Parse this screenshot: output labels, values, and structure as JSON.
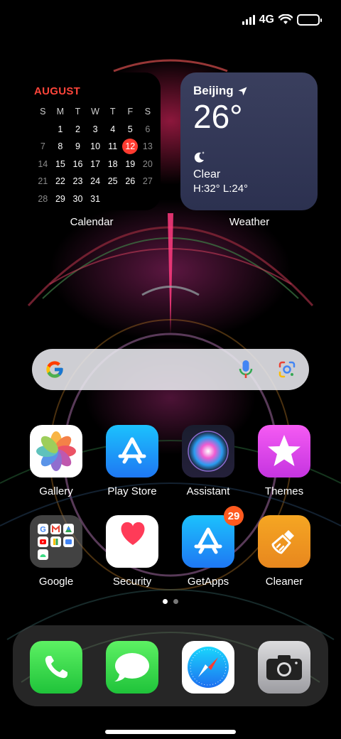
{
  "status_bar": {
    "network": "4G",
    "signal_icon": "cellular-signal-icon",
    "wifi_icon": "wifi-icon",
    "battery_icon": "battery-icon"
  },
  "calendar_widget": {
    "month": "AUGUST",
    "weekdays": [
      "S",
      "M",
      "T",
      "W",
      "T",
      "F",
      "S"
    ],
    "weeks": [
      [
        "",
        "",
        "1",
        "2",
        "3",
        "4",
        "5",
        "6"
      ],
      [
        "7",
        "8",
        "9",
        "10",
        "11",
        "12",
        "13"
      ],
      [
        "14",
        "15",
        "16",
        "17",
        "18",
        "19",
        "20"
      ],
      [
        "21",
        "22",
        "23",
        "24",
        "25",
        "26",
        "27"
      ],
      [
        "28",
        "29",
        "30",
        "31",
        "",
        "",
        ""
      ]
    ],
    "today": "12",
    "label": "Calendar"
  },
  "weather_widget": {
    "city": "Beijing",
    "temperature": "26°",
    "condition": "Clear",
    "high_low": "H:32°  L:24°",
    "label": "Weather",
    "condition_icon": "moon-stars-icon",
    "location_icon": "location-arrow-icon"
  },
  "search_bar": {
    "logo": "google-g-logo",
    "mic_icon": "microphone-icon",
    "lens_icon": "google-lens-icon"
  },
  "apps": [
    {
      "label": "Gallery",
      "icon": "photos-flower-icon"
    },
    {
      "label": "Play Store",
      "icon": "app-store-icon"
    },
    {
      "label": "Assistant",
      "icon": "siri-orb-icon"
    },
    {
      "label": "Themes",
      "icon": "star-icon"
    },
    {
      "label": "Google",
      "icon": "folder-icon"
    },
    {
      "label": "Security",
      "icon": "heart-icon"
    },
    {
      "label": "GetApps",
      "icon": "app-store-icon",
      "badge": "29"
    },
    {
      "label": "Cleaner",
      "icon": "broom-icon"
    }
  ],
  "page_indicator": {
    "pages": 2,
    "current": 1
  },
  "dock": [
    {
      "name": "phone",
      "icon": "phone-handset-icon"
    },
    {
      "name": "messages",
      "icon": "message-bubble-icon"
    },
    {
      "name": "browser",
      "icon": "compass-icon"
    },
    {
      "name": "camera",
      "icon": "camera-icon"
    }
  ],
  "colors": {
    "calendar_accent": "#ff453a",
    "weather_bg": "#353a58",
    "badge": "#ff5a1f"
  }
}
